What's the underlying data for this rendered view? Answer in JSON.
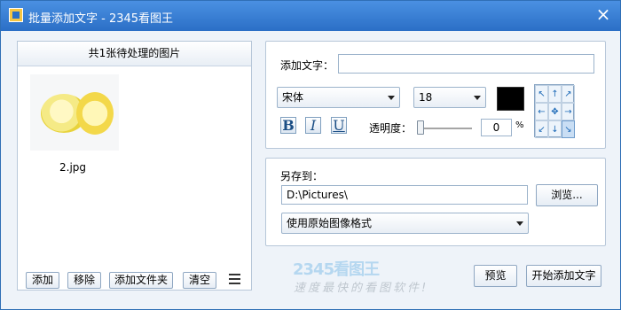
{
  "window": {
    "title": "批量添加文字 - 2345看图王",
    "close_icon": "×"
  },
  "left": {
    "header": "共1张待处理的图片",
    "image_caption": "2.jpg",
    "buttons": [
      "添加",
      "移除",
      "添加文件夹",
      "清空"
    ]
  },
  "text_options": {
    "add_text_label": "添加文字：",
    "add_text_value": "",
    "font_family": "宋体",
    "font_size": "18",
    "color": "#000000",
    "bold": "B",
    "italic": "I",
    "underline": "U",
    "opacity_label": "透明度：",
    "opacity_value": "0",
    "opacity_unit": "%",
    "alignment_icons": [
      "top-left-icon",
      "top-center-icon",
      "top-right-icon",
      "middle-left-icon",
      "center-icon",
      "middle-right-icon",
      "bottom-left-icon",
      "bottom-center-icon",
      "bottom-right-icon"
    ]
  },
  "save_options": {
    "label": "另存到：",
    "path": "D:\\Pictures\\",
    "browse": "浏览...",
    "format": "使用原始图像格式"
  },
  "watermark": {
    "logo": "2345看图王",
    "slogan": "速度最快的看图软件!"
  },
  "actions": {
    "preview": "预览",
    "start": "开始添加文字"
  }
}
